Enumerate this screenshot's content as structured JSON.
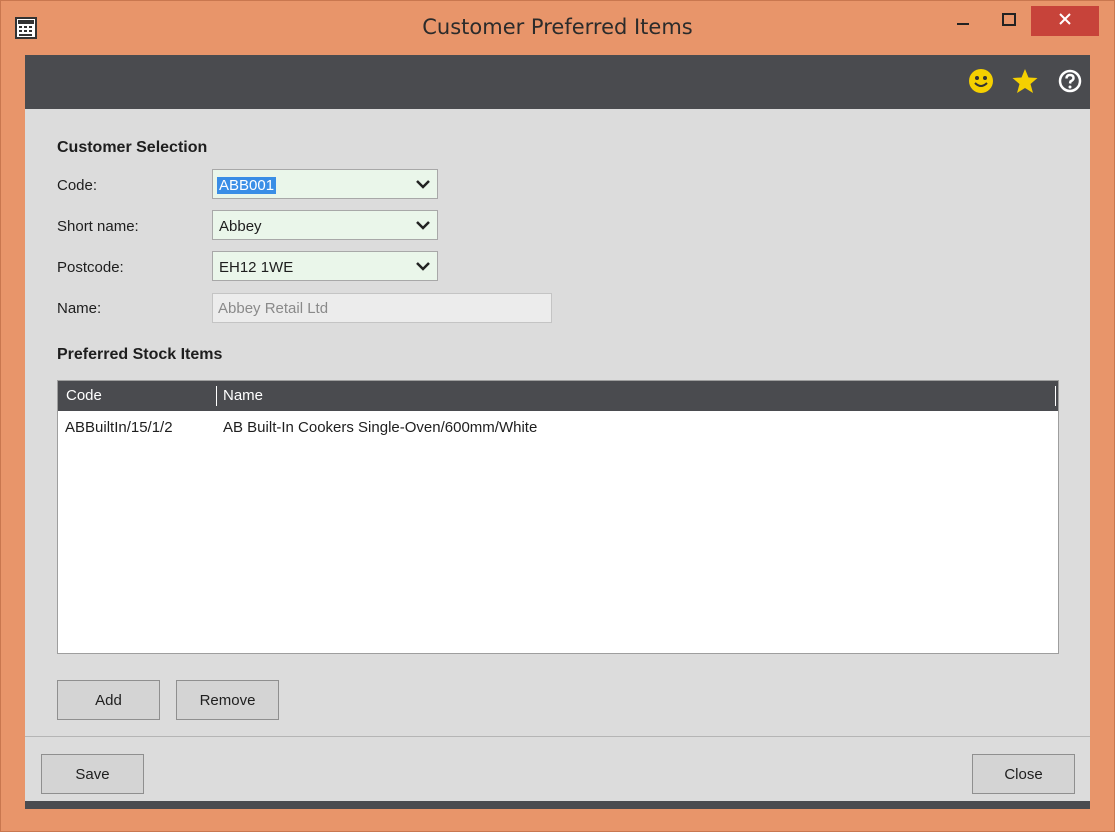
{
  "window": {
    "title": "Customer Preferred Items",
    "controls": [
      "minimize-icon",
      "maximize-icon",
      "close-icon"
    ]
  },
  "toolbar": {
    "icons": [
      "smiley-icon",
      "star-icon",
      "help-icon"
    ]
  },
  "customer_selection": {
    "title": "Customer Selection",
    "code_label": "Code:",
    "code_value": "ABB001",
    "short_name_label": "Short name:",
    "short_name_value": "Abbey",
    "postcode_label": "Postcode:",
    "postcode_value": "EH12 1WE",
    "name_label": "Name:",
    "name_value": "Abbey Retail Ltd"
  },
  "preferred_items": {
    "title": "Preferred Stock Items",
    "columns": [
      "Code",
      "Name"
    ],
    "rows": [
      {
        "code": "ABBuiltIn/15/1/2",
        "name": "AB Built-In Cookers Single-Oven/600mm/White"
      }
    ]
  },
  "buttons": {
    "add": "Add",
    "remove": "Remove",
    "save": "Save",
    "close": "Close"
  },
  "colors": {
    "window_frame": "#e8956a",
    "toolbar": "#4a4b4f",
    "combo_bg": "#eaf6ea",
    "close_button": "#c7433a",
    "icon_yellow": "#f5d000"
  }
}
